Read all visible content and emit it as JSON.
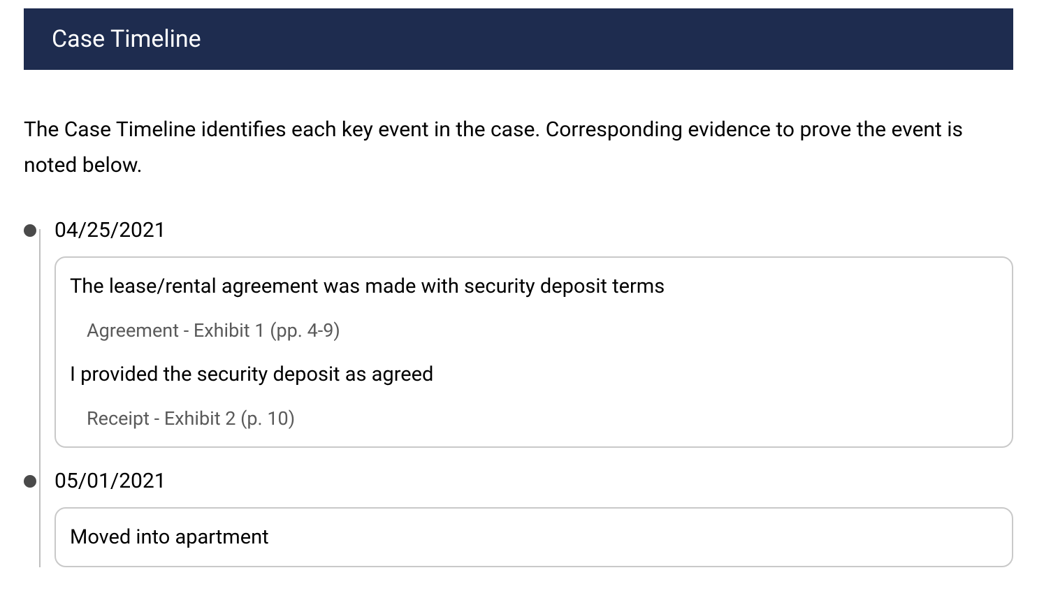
{
  "header": {
    "title": "Case Timeline"
  },
  "description": "The Case Timeline identifies each key event in the case.  Corresponding evidence to prove the event is noted below.",
  "timeline": [
    {
      "date": "04/25/2021",
      "items": [
        {
          "title": "The lease/rental agreement was made with security deposit terms",
          "evidence": "Agreement - Exhibit 1 (pp. 4-9)"
        },
        {
          "title": "I provided the security deposit as agreed",
          "evidence": "Receipt - Exhibit 2 (p. 10)"
        }
      ]
    },
    {
      "date": "05/01/2021",
      "items": [
        {
          "title": "Moved into apartment"
        }
      ]
    }
  ]
}
